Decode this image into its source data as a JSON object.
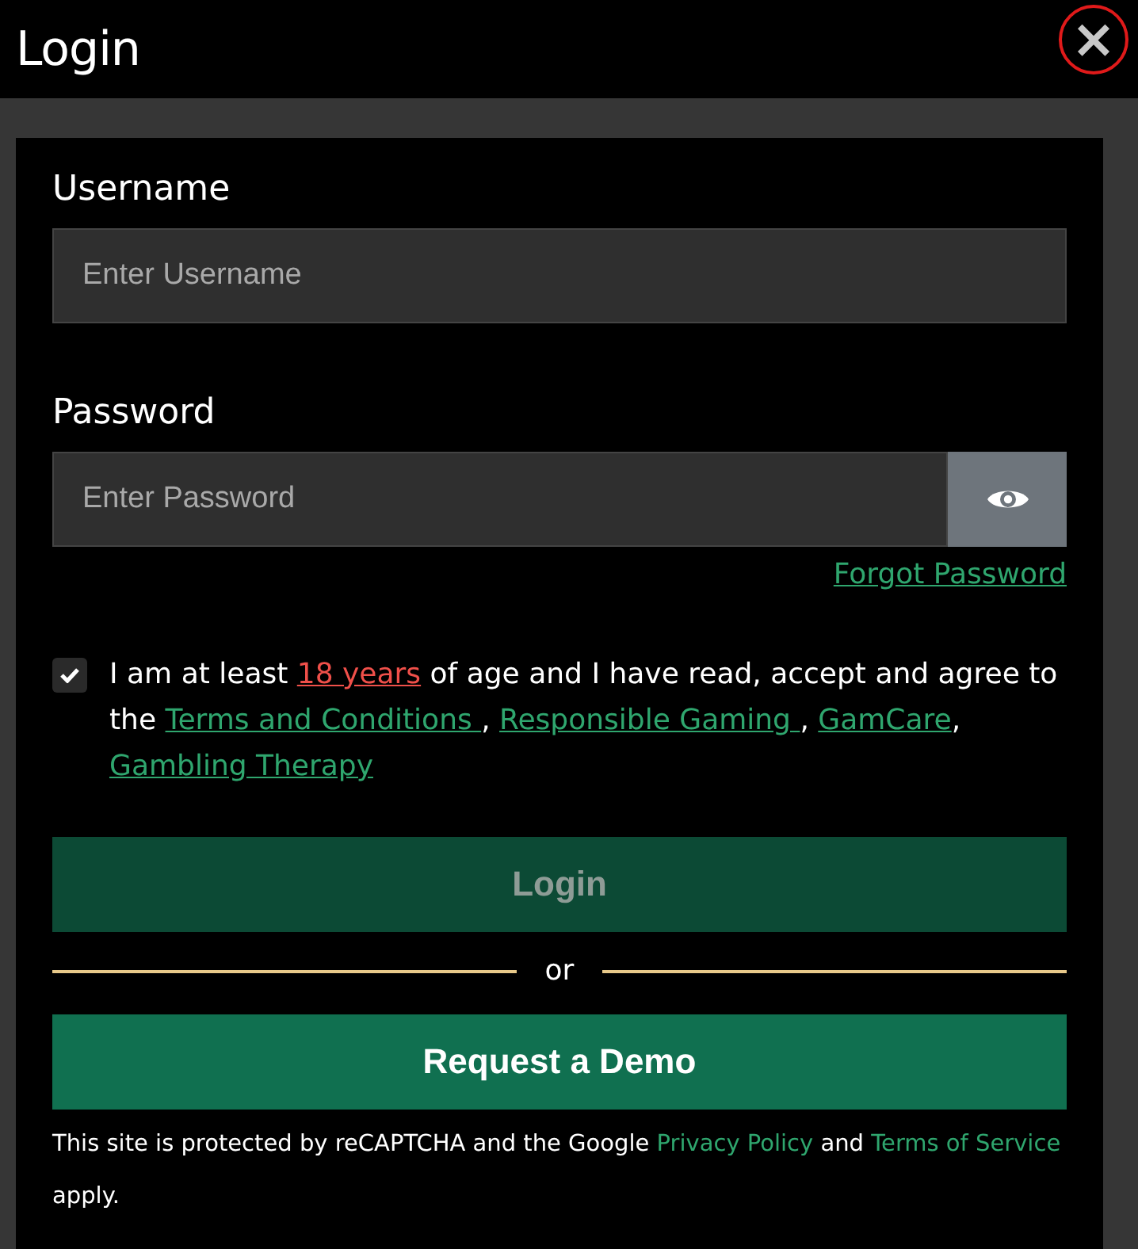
{
  "header": {
    "title": "Login",
    "close": "×"
  },
  "username": {
    "label": "Username",
    "placeholder": "Enter Username"
  },
  "password": {
    "label": "Password",
    "placeholder": "Enter Password",
    "forgot": "Forgot Password"
  },
  "consent": {
    "checked": true,
    "parts": [
      {
        "kind": "text",
        "text": "I am at least "
      },
      {
        "kind": "warn_link",
        "text": "18 years"
      },
      {
        "kind": "text",
        "text": " of age and I have read, accept and agree to the "
      },
      {
        "kind": "link",
        "text": "Terms and Conditions "
      },
      {
        "kind": "text",
        "text": ", "
      },
      {
        "kind": "link",
        "text": "Responsible Gaming "
      },
      {
        "kind": "text",
        "text": ", "
      },
      {
        "kind": "link",
        "text": "GamCare"
      },
      {
        "kind": "text",
        "text": ", "
      },
      {
        "kind": "link",
        "text": "Gambling Therapy"
      }
    ]
  },
  "login_button": {
    "label": "Login",
    "disabled": true
  },
  "separator": "or",
  "demo_button": {
    "label": "Request a Demo"
  },
  "footer": [
    {
      "kind": "text",
      "text": "This site is protected by reCAPTCHA and the Google "
    },
    {
      "kind": "link",
      "text": "Privacy Policy"
    },
    {
      "kind": "text",
      "text": " and "
    },
    {
      "kind": "link",
      "text": "Terms of Service"
    },
    {
      "kind": "text",
      "text": " apply."
    }
  ]
}
